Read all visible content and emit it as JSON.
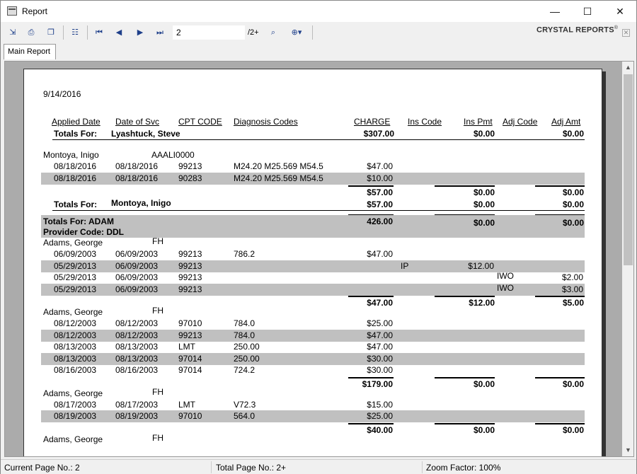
{
  "window": {
    "title": "Report",
    "minimize": "—",
    "maximize": "☐",
    "close": "✕"
  },
  "toolbar": {
    "page_input": "2",
    "page_total": "/2+",
    "logo": "CRYSTAL REPORTS",
    "logo_mark": "®"
  },
  "tabs": {
    "main": "Main Report"
  },
  "report": {
    "date": "9/14/2016",
    "headers": {
      "applied_date": "Applied Date",
      "date_of_svc": "Date of Svc",
      "cpt_code": "CPT CODE",
      "diagnosis": "Diagnosis Codes",
      "charge": "CHARGE",
      "ins_code": "Ins Code",
      "ins_pmt": "Ins Pmt",
      "adj_code": "Adj Code",
      "adj_amt": "Adj Amt"
    },
    "totals_label": "Totals For:",
    "lyashtuck": {
      "name": "Lyashtuck, Steve",
      "charge": "$307.00",
      "ins_pmt": "$0.00",
      "adj_amt": "$0.00"
    },
    "montoya": {
      "name": "Montoya, Inigo",
      "code": "AAALI0000",
      "rows": [
        {
          "applied": "08/18/2016",
          "svc": "08/18/2016",
          "cpt": "99213",
          "diag": "M24.20 M25.569 M54.5",
          "charge": "$47.00"
        },
        {
          "applied": "08/18/2016",
          "svc": "08/18/2016",
          "cpt": "90283",
          "diag": "M24.20 M25.569 M54.5",
          "charge": "$10.00"
        }
      ],
      "subtotal": {
        "charge": "$57.00",
        "ins_pmt": "$0.00",
        "adj_amt": "$0.00"
      },
      "total": {
        "name": "Montoya, Inigo",
        "charge": "$57.00",
        "ins_pmt": "$0.00",
        "adj_amt": "$0.00"
      }
    },
    "adam_total": {
      "label": "Totals For:  ADAM",
      "charge": "426.00",
      "ins_pmt": "$0.00",
      "adj_amt": "$0.00"
    },
    "provider_code": "Provider Code: DDL",
    "groups": [
      {
        "name": "Adams, George",
        "code": "FH",
        "rows": [
          {
            "applied": "06/09/2003",
            "svc": "06/09/2003",
            "cpt": "99213",
            "diag": "786.2",
            "charge": "$47.00",
            "ins_code": "",
            "ins_pmt": "",
            "adj_code": "",
            "adj_amt": ""
          },
          {
            "applied": "05/29/2013",
            "svc": "06/09/2003",
            "cpt": "99213",
            "diag": "",
            "charge": "",
            "ins_code": "IP",
            "ins_pmt": "$12.00",
            "adj_code": "",
            "adj_amt": ""
          },
          {
            "applied": "05/29/2013",
            "svc": "06/09/2003",
            "cpt": "99213",
            "diag": "",
            "charge": "",
            "ins_code": "",
            "ins_pmt": "",
            "adj_code": "IWO",
            "adj_amt": "$2.00"
          },
          {
            "applied": "05/29/2013",
            "svc": "06/09/2003",
            "cpt": "99213",
            "diag": "",
            "charge": "",
            "ins_code": "",
            "ins_pmt": "",
            "adj_code": "IWO",
            "adj_amt": "$3.00"
          }
        ],
        "subtotal": {
          "charge": "$47.00",
          "ins_pmt": "$12.00",
          "adj_amt": "$5.00"
        }
      },
      {
        "name": "Adams, George",
        "code": "FH",
        "rows": [
          {
            "applied": "08/12/2003",
            "svc": "08/12/2003",
            "cpt": "97010",
            "diag": "784.0",
            "charge": "$25.00",
            "ins_code": "",
            "ins_pmt": "",
            "adj_code": "",
            "adj_amt": ""
          },
          {
            "applied": "08/12/2003",
            "svc": "08/12/2003",
            "cpt": "99213",
            "diag": "784.0",
            "charge": "$47.00",
            "ins_code": "",
            "ins_pmt": "",
            "adj_code": "",
            "adj_amt": ""
          },
          {
            "applied": "08/13/2003",
            "svc": "08/13/2003",
            "cpt": "LMT",
            "diag": "250.00",
            "charge": "$47.00",
            "ins_code": "",
            "ins_pmt": "",
            "adj_code": "",
            "adj_amt": ""
          },
          {
            "applied": "08/13/2003",
            "svc": "08/13/2003",
            "cpt": "97014",
            "diag": "250.00",
            "charge": "$30.00",
            "ins_code": "",
            "ins_pmt": "",
            "adj_code": "",
            "adj_amt": ""
          },
          {
            "applied": "08/16/2003",
            "svc": "08/16/2003",
            "cpt": "97014",
            "diag": "724.2",
            "charge": "$30.00",
            "ins_code": "",
            "ins_pmt": "",
            "adj_code": "",
            "adj_amt": ""
          }
        ],
        "subtotal": {
          "charge": "$179.00",
          "ins_pmt": "$0.00",
          "adj_amt": "$0.00"
        }
      },
      {
        "name": "Adams, George",
        "code": "FH",
        "rows": [
          {
            "applied": "08/17/2003",
            "svc": "08/17/2003",
            "cpt": "LMT",
            "diag": "V72.3",
            "charge": "$15.00",
            "ins_code": "",
            "ins_pmt": "",
            "adj_code": "",
            "adj_amt": ""
          },
          {
            "applied": "08/19/2003",
            "svc": "08/19/2003",
            "cpt": "97010",
            "diag": "564.0",
            "charge": "$25.00",
            "ins_code": "",
            "ins_pmt": "",
            "adj_code": "",
            "adj_amt": ""
          }
        ],
        "subtotal": {
          "charge": "$40.00",
          "ins_pmt": "$0.00",
          "adj_amt": "$0.00"
        }
      },
      {
        "name": "Adams, George",
        "code": "FH",
        "rows": [],
        "subtotal": null
      }
    ]
  },
  "status": {
    "current_page": "Current Page No.: 2",
    "total_page": "Total Page No.: 2+",
    "zoom": "Zoom Factor: 100%"
  }
}
